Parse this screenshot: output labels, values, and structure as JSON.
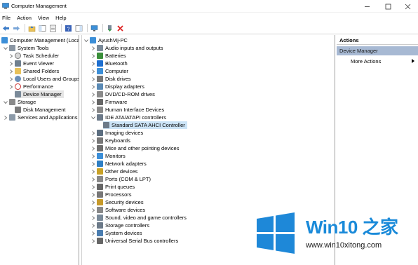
{
  "window": {
    "title": "Computer Management"
  },
  "menubar": {
    "items": [
      "File",
      "Action",
      "View",
      "Help"
    ]
  },
  "left_tree": {
    "root": "Computer Management (Local",
    "system_tools": "System Tools",
    "task_scheduler": "Task Scheduler",
    "event_viewer": "Event Viewer",
    "shared_folders": "Shared Folders",
    "local_users": "Local Users and Groups",
    "performance": "Performance",
    "device_manager": "Device Manager",
    "storage": "Storage",
    "disk_management": "Disk Management",
    "services": "Services and Applications"
  },
  "device_tree": {
    "computer_name": "AyushVij-PC",
    "categories": [
      {
        "label": "Audio inputs and outputs",
        "icon": "speaker-icon",
        "color": "#7a8a99"
      },
      {
        "label": "Batteries",
        "icon": "battery-icon",
        "color": "#3a8f3a"
      },
      {
        "label": "Bluetooth",
        "icon": "bluetooth-icon",
        "color": "#1e6fd0"
      },
      {
        "label": "Computer",
        "icon": "monitor-icon",
        "color": "#3c8fd8"
      },
      {
        "label": "Disk drives",
        "icon": "disk-icon",
        "color": "#777777"
      },
      {
        "label": "Display adapters",
        "icon": "display-adapter-icon",
        "color": "#5a8ab5"
      },
      {
        "label": "DVD/CD-ROM drives",
        "icon": "dvd-icon",
        "color": "#8a8a8a"
      },
      {
        "label": "Firmware",
        "icon": "chip-icon",
        "color": "#666666"
      },
      {
        "label": "Human Interface Devices",
        "icon": "hid-icon",
        "color": "#888888"
      },
      {
        "label": "IDE ATA/ATAPI controllers",
        "icon": "controller-icon",
        "color": "#6c7a89"
      }
    ],
    "expanded_child": "Standard SATA AHCI Controller",
    "categories_after": [
      {
        "label": "Imaging devices",
        "icon": "camera-icon",
        "color": "#5c6e80"
      },
      {
        "label": "Keyboards",
        "icon": "keyboard-icon",
        "color": "#777777"
      },
      {
        "label": "Mice and other pointing devices",
        "icon": "mouse-icon",
        "color": "#6d6d6d"
      },
      {
        "label": "Monitors",
        "icon": "monitor-icon",
        "color": "#3c8fd8"
      },
      {
        "label": "Network adapters",
        "icon": "network-icon",
        "color": "#2f7fc4"
      },
      {
        "label": "Other devices",
        "icon": "unknown-device-icon",
        "color": "#c9a227"
      },
      {
        "label": "Ports (COM & LPT)",
        "icon": "port-icon",
        "color": "#888888"
      },
      {
        "label": "Print queues",
        "icon": "printer-icon",
        "color": "#666666"
      },
      {
        "label": "Processors",
        "icon": "cpu-icon",
        "color": "#777777"
      },
      {
        "label": "Security devices",
        "icon": "lock-icon",
        "color": "#c79a2a"
      },
      {
        "label": "Software devices",
        "icon": "software-device-icon",
        "color": "#888888"
      },
      {
        "label": "Sound, video and game controllers",
        "icon": "speaker-icon",
        "color": "#7a8a99"
      },
      {
        "label": "Storage controllers",
        "icon": "storage-controller-icon",
        "color": "#6c7a89"
      },
      {
        "label": "System devices",
        "icon": "system-device-icon",
        "color": "#4a7db0"
      },
      {
        "label": "Universal Serial Bus controllers",
        "icon": "usb-icon",
        "color": "#666666"
      }
    ]
  },
  "actions": {
    "header": "Actions",
    "section": "Device Manager",
    "more": "More Actions"
  },
  "watermark": {
    "title": "Win10 之家",
    "url": "www.win10xitong.com"
  }
}
